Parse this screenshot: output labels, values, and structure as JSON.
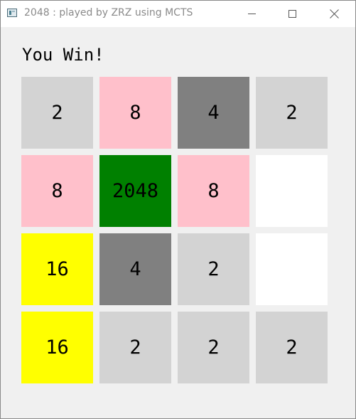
{
  "window": {
    "title": "2048 : played by ZRZ using MCTS",
    "icon": "app-icon"
  },
  "status": "You Win!",
  "colors": {
    "empty": "#ffffff",
    "2": "#d3d3d3",
    "4": "#808080",
    "8": "#ffc0cb",
    "16": "#ffff00",
    "2048": "#008000"
  },
  "board": [
    [
      "2",
      "8",
      "4",
      "2"
    ],
    [
      "8",
      "2048",
      "8",
      ""
    ],
    [
      "16",
      "4",
      "2",
      ""
    ],
    [
      "16",
      "2",
      "2",
      "2"
    ]
  ]
}
